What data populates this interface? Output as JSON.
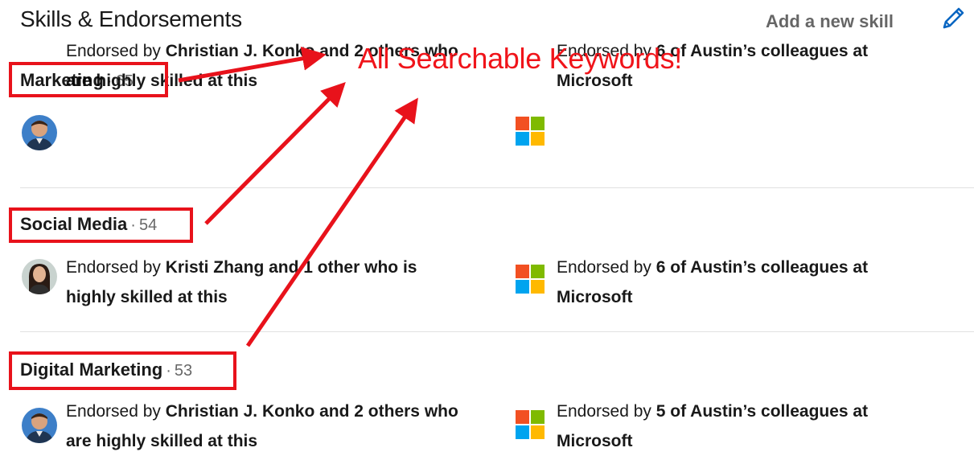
{
  "header": {
    "title": "Skills & Endorsements",
    "add_label": "Add a new skill",
    "edit_icon": "pencil-icon"
  },
  "annotation": {
    "text": "All Searchable Keywords!",
    "color": "#e8121b"
  },
  "skills": [
    {
      "name": "Marketing",
      "separator": "·",
      "count": "65",
      "endorsed_prefix": "Endorsed by",
      "endorser": "Christian J. Konko and 2 others who are highly skilled at this",
      "avatar": "avatar-man",
      "company_prefix": "Endorsed by",
      "company_text": "6 of Austin’s colleagues at Microsoft",
      "company_icon": "microsoft-logo-icon"
    },
    {
      "name": "Social Media",
      "separator": "·",
      "count": "54",
      "endorsed_prefix": "Endorsed by",
      "endorser": "Kristi Zhang and 1 other who is",
      "endorser_tail": "highly skilled at this",
      "avatar": "avatar-woman",
      "company_prefix": "Endorsed by",
      "company_text": "6 of Austin’s colleagues at Microsoft",
      "company_icon": "microsoft-logo-icon"
    },
    {
      "name": "Digital Marketing",
      "separator": "·",
      "count": "53",
      "endorsed_prefix": "Endorsed by",
      "endorser": "Christian J. Konko and 2 others who are highly skilled at this",
      "avatar": "avatar-man",
      "company_prefix": "Endorsed by",
      "company_text": "5 of Austin’s colleagues at Microsoft",
      "company_icon": "microsoft-logo-icon"
    }
  ],
  "colors": {
    "ms_red": "#f25022",
    "ms_green": "#7fba00",
    "ms_blue": "#00a4ef",
    "ms_yellow": "#ffb900",
    "pencil": "#0a66c2"
  }
}
